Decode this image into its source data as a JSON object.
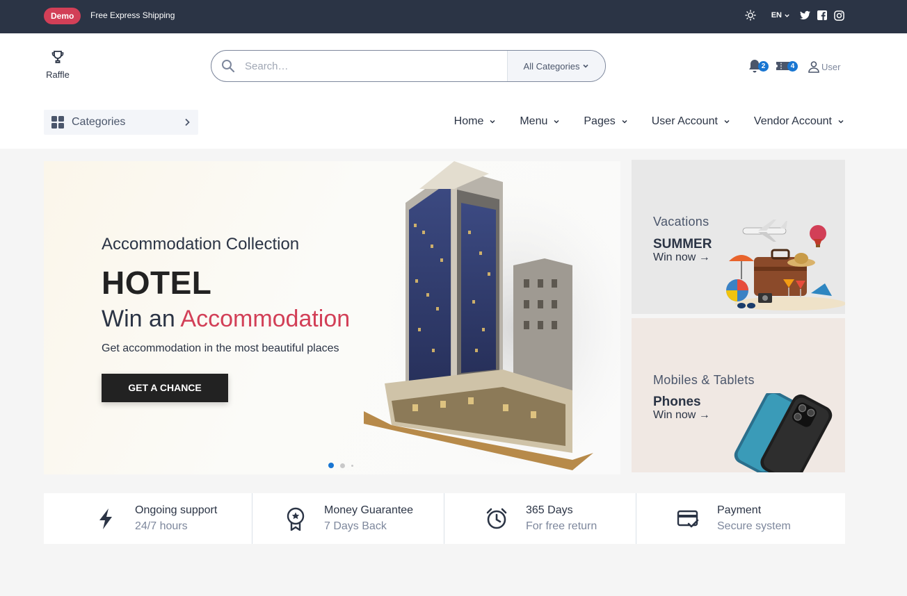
{
  "topbar": {
    "badge": "Demo",
    "promo": "Free Express Shipping",
    "language": "EN",
    "icons": [
      "sun-icon",
      "twitter-icon",
      "facebook-icon",
      "instagram-icon"
    ]
  },
  "header": {
    "logo_label": "Raffle",
    "search": {
      "placeholder": "Search…",
      "category_select": "All Categories"
    },
    "notifications_count": "2",
    "tickets_count": "4",
    "user_label": "User"
  },
  "navbar": {
    "categories_label": "Categories",
    "items": [
      "Home",
      "Menu",
      "Pages",
      "User Account",
      "Vendor Account"
    ]
  },
  "hero": {
    "subtitle": "Accommodation Collection",
    "title": "HOTEL",
    "win_prefix": "Win an",
    "win_accent": "Accommodation",
    "description": "Get accommodation in the most beautiful places",
    "cta": "GET A CHANCE",
    "slide_count": 3,
    "active_slide": 1
  },
  "promo_cards": [
    {
      "kicker": "Vacations",
      "title": "SUMMER",
      "link": "Win now →"
    },
    {
      "kicker": "Mobiles & Tablets",
      "title": "Phones",
      "link": "Win now →"
    }
  ],
  "services": [
    {
      "icon": "lightning-icon",
      "title": "Ongoing support",
      "subtitle": "24/7 hours"
    },
    {
      "icon": "award-icon",
      "title": "Money Guarantee",
      "subtitle": "7 Days Back"
    },
    {
      "icon": "alarm-clock-icon",
      "title": "365 Days",
      "subtitle": "For free return"
    },
    {
      "icon": "credit-card-icon",
      "title": "Payment",
      "subtitle": "Secure system"
    }
  ],
  "colors": {
    "topbar_bg": "#2b3445",
    "accent": "#d23f57",
    "primary_blue": "#1976d2",
    "text_dark": "#2b3445",
    "text_muted": "#7d879c"
  }
}
